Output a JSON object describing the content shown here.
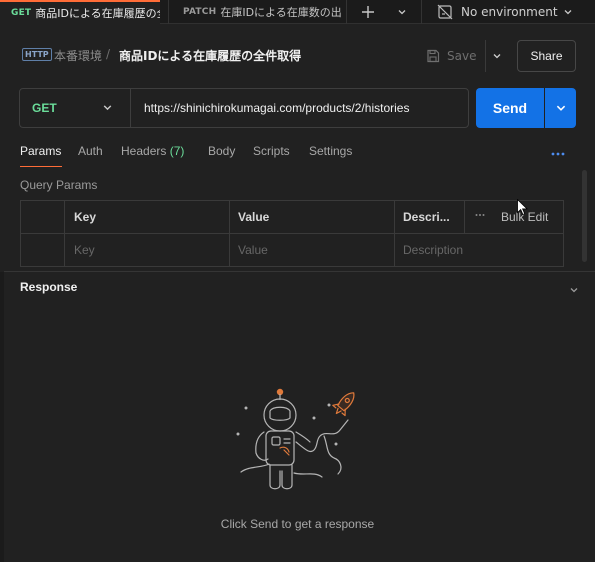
{
  "tabbar": {
    "tabs": [
      {
        "method": "GET",
        "title": "商品IDによる在庫履歴の全件取得",
        "active": true
      },
      {
        "method": "PATCH",
        "title": "在庫IDによる在庫数の出",
        "unsaved": true
      }
    ],
    "add_icon": "plus-icon",
    "more_icon": "chevron-down-icon",
    "environment": {
      "icon": "no-environment-icon",
      "label": "No environment"
    }
  },
  "breadcrumb": {
    "icon": "HTTP",
    "parent": "本番環境",
    "separator": "/",
    "current": "商品IDによる在庫履歴の全件取得"
  },
  "actions": {
    "save_label": "Save",
    "share_label": "Share"
  },
  "request": {
    "method": "GET",
    "url": "https://shinichirokumagai.com/products/2/histories",
    "send_label": "Send"
  },
  "request_tabs": [
    {
      "label": "Params",
      "active": true
    },
    {
      "label": "Auth"
    },
    {
      "label": "Headers",
      "count": "(7)"
    },
    {
      "label": "Body"
    },
    {
      "label": "Scripts"
    },
    {
      "label": "Settings"
    }
  ],
  "params": {
    "section_label": "Query Params",
    "columns": [
      "Key",
      "Value",
      "Descri..."
    ],
    "bulk_edit_label": "Bulk Edit",
    "placeholders": {
      "key": "Key",
      "value": "Value",
      "description": "Description"
    }
  },
  "response": {
    "label": "Response",
    "empty_text": "Click Send to get a response"
  },
  "colors": {
    "accent": "#ff6c37",
    "get": "#6bdd9a",
    "send": "#1372e6",
    "link": "#4d8df0"
  }
}
